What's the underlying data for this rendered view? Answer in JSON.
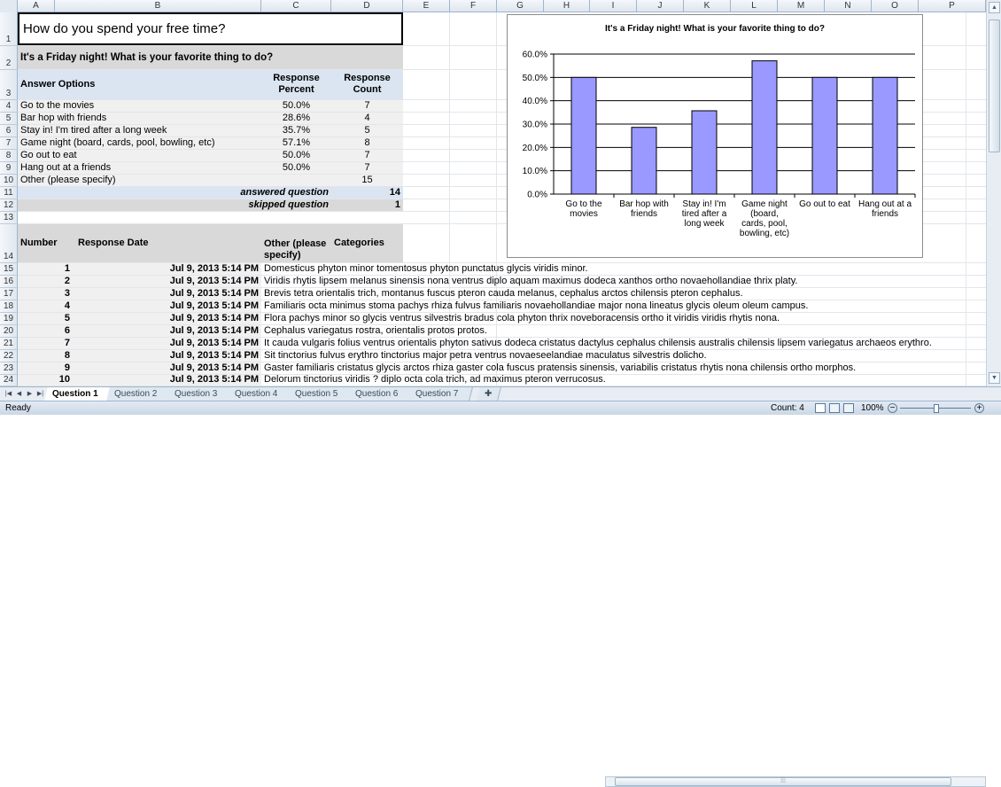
{
  "columns": [
    "A",
    "B",
    "C",
    "D",
    "E",
    "F",
    "G",
    "H",
    "I",
    "J",
    "K",
    "L",
    "M",
    "N",
    "O",
    "P"
  ],
  "sheet": {
    "title": "How do you spend your free time?",
    "question": "It's a Friday night! What is your favorite thing to do?",
    "header_answer": "Answer Options",
    "header_percent": "Response Percent",
    "header_count": "Response Count",
    "answers": [
      {
        "label": "Go to the movies",
        "percent": "50.0%",
        "count": "7"
      },
      {
        "label": "Bar hop with friends",
        "percent": "28.6%",
        "count": "4"
      },
      {
        "label": "Stay in! I'm tired after a long week",
        "percent": "35.7%",
        "count": "5"
      },
      {
        "label": "Game night (board, cards, pool, bowling, etc)",
        "percent": "57.1%",
        "count": "8"
      },
      {
        "label": "Go out to eat",
        "percent": "50.0%",
        "count": "7"
      },
      {
        "label": "Hang out at a friends",
        "percent": "50.0%",
        "count": "7"
      }
    ],
    "other_label": "Other (please specify)",
    "other_count": "15",
    "answered_label": "answered question",
    "answered_value": "14",
    "skipped_label": "skipped question",
    "skipped_value": "1",
    "resp_header_number": "Number",
    "resp_header_date": "Response Date",
    "resp_header_other": "Other (please specify)",
    "resp_header_categories": "Categories",
    "responses": [
      {
        "n": "1",
        "date": "Jul 9, 2013 5:14 PM",
        "text": "Domesticus phyton minor tomentosus phyton punctatus glycis viridis minor."
      },
      {
        "n": "2",
        "date": "Jul 9, 2013 5:14 PM",
        "text": "Viridis rhytis lipsem melanus sinensis nona ventrus diplo aquam maximus dodeca xanthos ortho novaehollandiae thrix platy."
      },
      {
        "n": "3",
        "date": "Jul 9, 2013 5:14 PM",
        "text": "Brevis tetra orientalis trich, montanus fuscus pteron cauda melanus, cephalus arctos chilensis pteron cephalus."
      },
      {
        "n": "4",
        "date": "Jul 9, 2013 5:14 PM",
        "text": "Familiaris octa minimus stoma pachys rhiza fulvus familiaris novaehollandiae major nona lineatus glycis oleum oleum campus."
      },
      {
        "n": "5",
        "date": "Jul 9, 2013 5:14 PM",
        "text": "Flora pachys minor so glycis ventrus silvestris bradus cola phyton thrix noveboracensis ortho it viridis viridis rhytis nona."
      },
      {
        "n": "6",
        "date": "Jul 9, 2013 5:14 PM",
        "text": "Cephalus variegatus rostra, orientalis protos protos."
      },
      {
        "n": "7",
        "date": "Jul 9, 2013 5:14 PM",
        "text": "It cauda vulgaris folius ventrus orientalis phyton sativus dodeca cristatus dactylus cephalus chilensis australis chilensis lipsem variegatus archaeos erythro."
      },
      {
        "n": "8",
        "date": "Jul 9, 2013 5:14 PM",
        "text": "Sit tinctorius fulvus erythro tinctorius major petra ventrus novaeseelandiae maculatus silvestris dolicho."
      },
      {
        "n": "9",
        "date": "Jul 9, 2013 5:14 PM",
        "text": "Gaster familiaris cristatus glycis arctos rhiza gaster cola fuscus pratensis sinensis, variabilis cristatus rhytis nona chilensis ortho morphos."
      },
      {
        "n": "10",
        "date": "Jul 9, 2013 5:14 PM",
        "text": "Delorum tinctorius viridis ? diplo octa cola trich, ad maximus pteron verrucosus."
      }
    ]
  },
  "tabs": [
    "Question 1",
    "Question 2",
    "Question 3",
    "Question 4",
    "Question 5",
    "Question 6",
    "Question 7"
  ],
  "status": {
    "ready": "Ready",
    "count": "Count: 4",
    "zoom": "100%"
  },
  "chart_data": {
    "type": "bar",
    "title": "It's a Friday night! What is your favorite thing to do?",
    "categories": [
      "Go to the movies",
      "Bar hop with friends",
      "Stay in! I'm tired after a long week",
      "Game night (board, cards, pool, bowling, etc)",
      "Go out to eat",
      "Hang out at a friends"
    ],
    "values": [
      0.5,
      0.286,
      0.357,
      0.571,
      0.5,
      0.5
    ],
    "yticks": [
      "0.0%",
      "10.0%",
      "20.0%",
      "30.0%",
      "40.0%",
      "50.0%",
      "60.0%"
    ],
    "ylim": [
      0,
      0.6
    ],
    "grid": true,
    "bar_color": "#9999ff"
  }
}
